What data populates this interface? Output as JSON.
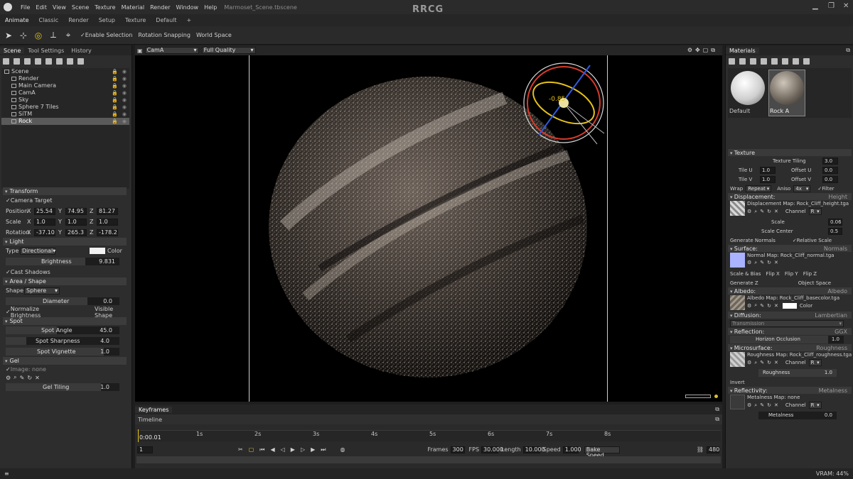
{
  "menubar": {
    "items": [
      "File",
      "Edit",
      "View",
      "Scene",
      "Texture",
      "Material",
      "Render",
      "Window",
      "Help"
    ],
    "file_title": "Marmoset_Scene.tbscene",
    "watermark": "RRCG"
  },
  "workspace_tabs": [
    "Animate",
    "Classic",
    "Render",
    "Setup",
    "Texture",
    "Default",
    "+"
  ],
  "toolbar": {
    "enable_selection": "Enable Selection",
    "rotation_snapping": "Rotation Snapping",
    "world_space": "World Space"
  },
  "left_panel": {
    "tabs": [
      "Scene",
      "Tool Settings",
      "History"
    ],
    "tree": [
      {
        "label": "Scene",
        "depth": 0
      },
      {
        "label": "Render",
        "depth": 1
      },
      {
        "label": "Main Camera",
        "depth": 1
      },
      {
        "label": "CamA",
        "depth": 1,
        "lock_red": true
      },
      {
        "label": "Sky",
        "depth": 1
      },
      {
        "label": "Sphere 7 Tiles",
        "depth": 1
      },
      {
        "label": "SiTM",
        "depth": 1
      },
      {
        "label": "Rock",
        "depth": 1,
        "selected": true
      }
    ],
    "transform": {
      "header": "Transform",
      "camera_target": "Camera Target",
      "position_label": "Position",
      "position": [
        "25.54",
        "74.95",
        "81.27"
      ],
      "scale_label": "Scale",
      "scale": [
        "1.0",
        "1.0",
        "1.0"
      ],
      "rotation_label": "Rotation",
      "rotation": [
        "-37.10",
        "265.3",
        "-178.2"
      ],
      "axes": [
        "X",
        "Y",
        "Z"
      ]
    },
    "light": {
      "header": "Light",
      "type_label": "Type",
      "type_value": "Directional",
      "color_label": "Color",
      "brightness_label": "Brightness",
      "brightness_value": "9.831",
      "cast_shadows": "Cast Shadows"
    },
    "area_shape": {
      "header": "Area / Shape",
      "shape_label": "Shape",
      "shape_value": "Sphere",
      "diameter_label": "Diameter",
      "diameter_value": "0.0",
      "normalize": "Normalize Brightness",
      "visible_shape": "Visible Shape"
    },
    "spot": {
      "header": "Spot",
      "angle_label": "Spot Angle",
      "angle_value": "45.0",
      "sharpness_label": "Spot Sharpness",
      "sharpness_value": "4.0",
      "vignette_label": "Spot Vignette",
      "vignette_value": "1.0"
    },
    "gel": {
      "header": "Gel",
      "image_label": "Image: none",
      "tiling_label": "Gel Tiling",
      "tiling_value": "1.0"
    }
  },
  "viewport": {
    "camera": "CamA",
    "quality": "Full Quality",
    "gizmo_readout": "-0.85"
  },
  "timeline": {
    "tabs": [
      "Keyframes",
      "Timeline"
    ],
    "timecode": "0:00.01",
    "ticks": [
      "1s",
      "2s",
      "3s",
      "4s",
      "5s",
      "6s",
      "7s",
      "8s"
    ],
    "frame_field": "1",
    "frames_label": "Frames",
    "frames_value": "300",
    "fps_label": "FPS",
    "fps_value": "30.000",
    "length_label": "Length",
    "length_value": "10.000",
    "speed_label": "Speed",
    "speed_value": "1.000",
    "bake_speed": "Bake Speed",
    "end_value": "480"
  },
  "right_panel": {
    "tab": "Materials",
    "materials": [
      {
        "name": "Default",
        "color": "#ececec"
      },
      {
        "name": "Rock A",
        "color": "#8a8378"
      }
    ],
    "texture": {
      "header": "Texture",
      "texture_tiling_label": "Texture Tiling",
      "texture_tiling_value": "3.0",
      "tile_u_label": "Tile U",
      "tile_u_value": "1.0",
      "offset_u_label": "Offset U",
      "offset_u_value": "0.0",
      "tile_v_label": "Tile V",
      "tile_v_value": "1.0",
      "offset_v_label": "Offset V",
      "offset_v_value": "0.0",
      "wrap_label": "Wrap",
      "wrap_value": "Repeat",
      "aniso_label": "Aniso",
      "aniso_value": "4x",
      "filter_label": "Filter"
    },
    "displacement": {
      "header": "Displacement:",
      "mode": "Height",
      "map_label": "Displacement Map: Rock_Cliff_height.tga",
      "channel_label": "Channel",
      "channel_value": "R",
      "scale_label": "Scale",
      "scale_value": "0.06",
      "scale_center_label": "Scale Center",
      "scale_center_value": "0.5",
      "generate_normals": "Generate Normals",
      "relative_scale": "Relative Scale"
    },
    "surface": {
      "header": "Surface:",
      "mode": "Normals",
      "map_label": "Normal Map: Rock_Cliff_normal.tga",
      "scale_bias": "Scale & Bias",
      "flip_x": "Flip X",
      "flip_y": "Flip Y",
      "flip_z": "Flip Z",
      "generate_z": "Generate Z",
      "object_space": "Object Space"
    },
    "albedo": {
      "header": "Albedo:",
      "mode": "Albedo",
      "map_label": "Albedo Map: Rock_Cliff_basecolor.tga",
      "color_label": "Color"
    },
    "diffusion": {
      "header": "Diffusion:",
      "mode": "Lambertian",
      "sub": "Transmission"
    },
    "reflection": {
      "header": "Reflection:",
      "mode": "GGX",
      "horizon_label": "Horizon Occlusion",
      "horizon_value": "1.0"
    },
    "microsurface": {
      "header": "Microsurface:",
      "mode": "Roughness",
      "map_label": "Roughness Map: Rock_Cliff_roughness.tga",
      "channel_label": "Channel",
      "channel_value": "R",
      "roughness_label": "Roughness",
      "roughness_value": "1.0",
      "invert": "Invert"
    },
    "reflectivity": {
      "header": "Reflectivity:",
      "mode": "Metalness",
      "map_label": "Metalness Map: none",
      "channel_label": "Channel",
      "channel_value": "R",
      "metalness_label": "Metalness",
      "metalness_value": "0.0"
    }
  },
  "status": {
    "left": "≡",
    "vram": "VRAM: 44%"
  },
  "colors": {
    "accent_yellow": "#e6c21a",
    "gizmo_red": "#d83a2a",
    "gizmo_blue": "#2f5be0"
  }
}
